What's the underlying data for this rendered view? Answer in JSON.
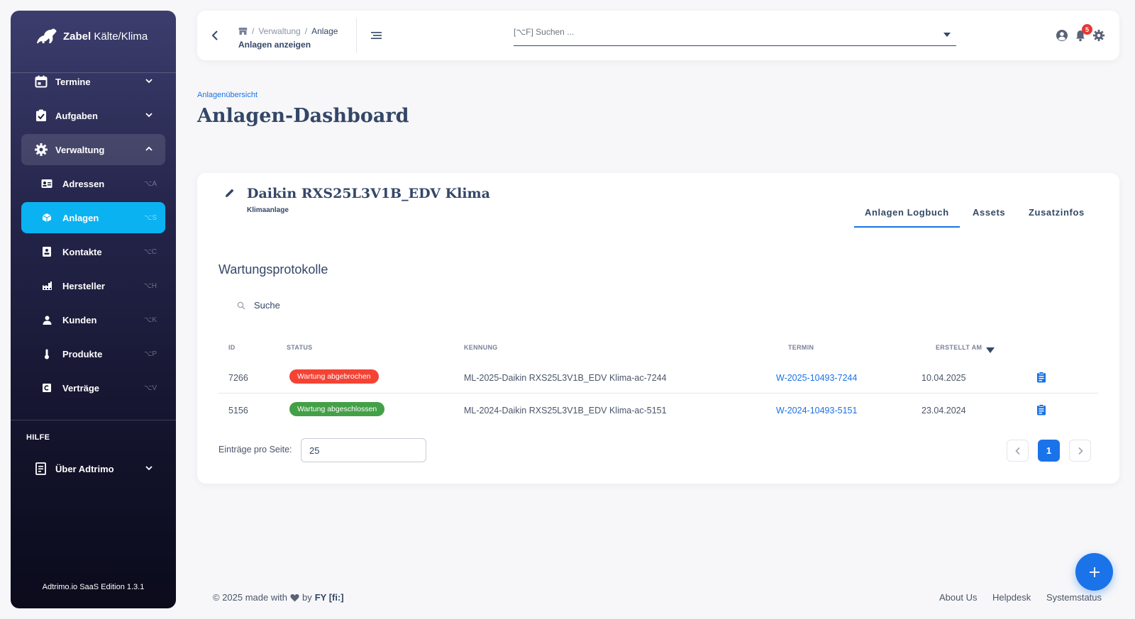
{
  "sidebar": {
    "brand_bold": "Zabel",
    "brand_rest": "Kälte/Klima",
    "items": [
      {
        "label": "Termine"
      },
      {
        "label": "Aufgaben"
      },
      {
        "label": "Verwaltung"
      }
    ],
    "subitems": [
      {
        "label": "Adressen",
        "shortcut": "⌥A"
      },
      {
        "label": "Anlagen",
        "shortcut": "⌥S"
      },
      {
        "label": "Kontakte",
        "shortcut": "⌥C"
      },
      {
        "label": "Hersteller",
        "shortcut": "⌥H"
      },
      {
        "label": "Kunden",
        "shortcut": "⌥K"
      },
      {
        "label": "Produkte",
        "shortcut": "⌥P"
      },
      {
        "label": "Verträge",
        "shortcut": "⌥V"
      }
    ],
    "help_heading": "HILFE",
    "help_item": "Über Adtrimo",
    "version": "Adtrimo.io SaaS Edition 1.3.1"
  },
  "topbar": {
    "breadcrumb_1": "Verwaltung",
    "breadcrumb_2": "Anlage",
    "breadcrumb_sep": "/",
    "subtitle": "Anlagen anzeigen",
    "search_placeholder": "[⌥F] Suchen ...",
    "notification_count": "5"
  },
  "page": {
    "overview_link": "Anlagenübersicht",
    "title": "Anlagen-Dashboard"
  },
  "device": {
    "title": "Daikin RXS25L3V1B_EDV Klima",
    "subtitle": "Klimaanlage",
    "tabs": [
      "Anlagen Logbuch",
      "Assets",
      "Zusatzinfos"
    ]
  },
  "protocols": {
    "title": "Wartungsprotokolle",
    "search_placeholder": "Suche",
    "columns": [
      "ID",
      "STATUS",
      "KENNUNG",
      "TERMIN",
      "ERSTELLT AM"
    ],
    "rows": [
      {
        "id": "7266",
        "status": "Wartung abgebrochen",
        "status_color": "#f44335",
        "kennung": "ML-2025-Daikin RXS25L3V1B_EDV Klima-ac-7244",
        "termin": "W-2025-10493-7244",
        "erstellt": "10.04.2025"
      },
      {
        "id": "5156",
        "status": "Wartung abgeschlossen",
        "status_color": "#43a047",
        "kennung": "ML-2024-Daikin RXS25L3V1B_EDV Klima-ac-5151",
        "termin": "W-2024-10493-5151",
        "erstellt": "23.04.2024"
      }
    ],
    "per_page_label": "Einträge pro Seite:",
    "per_page_value": "25",
    "current_page": "1"
  },
  "footer": {
    "copyright_prefix": "© 2025 made with",
    "copyright_by": "by",
    "copyright_brand": "FY [fi:]",
    "links": [
      "About Us",
      "Helpdesk",
      "Systemstatus"
    ]
  },
  "colors": {
    "accent": "#1a73e8",
    "sidebar_active": "#0ab2f2"
  }
}
